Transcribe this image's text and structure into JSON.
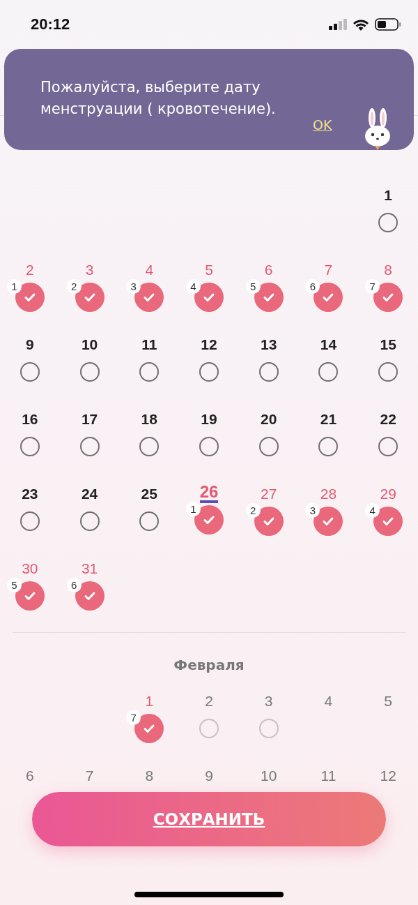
{
  "status_bar": {
    "time": "20:12"
  },
  "banner": {
    "message": "Пожалуйста, выберите дату менструации ( кровотечение).",
    "ok_link": "OK"
  },
  "months": [
    {
      "weeks": [
        [
          {
            "kind": "blank"
          },
          {
            "kind": "blank"
          },
          {
            "kind": "blank"
          },
          {
            "kind": "blank"
          },
          {
            "kind": "blank"
          },
          {
            "kind": "blank"
          },
          {
            "day": "1",
            "kind": "empty",
            "today": false
          }
        ],
        [
          {
            "day": "2",
            "kind": "checked",
            "order": "1",
            "today": false
          },
          {
            "day": "3",
            "kind": "checked",
            "order": "2",
            "today": false
          },
          {
            "day": "4",
            "kind": "checked",
            "order": "3",
            "today": false
          },
          {
            "day": "5",
            "kind": "checked",
            "order": "4",
            "today": false
          },
          {
            "day": "6",
            "kind": "checked",
            "order": "5",
            "today": false
          },
          {
            "day": "7",
            "kind": "checked",
            "order": "6",
            "today": false
          },
          {
            "day": "8",
            "kind": "checked",
            "order": "7",
            "today": false
          }
        ],
        [
          {
            "day": "9",
            "kind": "empty",
            "today": false
          },
          {
            "day": "10",
            "kind": "empty",
            "today": false
          },
          {
            "day": "11",
            "kind": "empty",
            "today": false
          },
          {
            "day": "12",
            "kind": "empty",
            "today": false
          },
          {
            "day": "13",
            "kind": "empty",
            "today": false
          },
          {
            "day": "14",
            "kind": "empty",
            "today": false
          },
          {
            "day": "15",
            "kind": "empty",
            "today": false
          }
        ],
        [
          {
            "day": "16",
            "kind": "empty",
            "today": false
          },
          {
            "day": "17",
            "kind": "empty",
            "today": false
          },
          {
            "day": "18",
            "kind": "empty",
            "today": false
          },
          {
            "day": "19",
            "kind": "empty",
            "today": false
          },
          {
            "day": "20",
            "kind": "empty",
            "today": false
          },
          {
            "day": "21",
            "kind": "empty",
            "today": false
          },
          {
            "day": "22",
            "kind": "empty",
            "today": false
          }
        ],
        [
          {
            "day": "23",
            "kind": "empty",
            "today": false
          },
          {
            "day": "24",
            "kind": "empty",
            "today": false
          },
          {
            "day": "25",
            "kind": "empty",
            "today": false
          },
          {
            "day": "26",
            "kind": "checked",
            "order": "1",
            "today": true
          },
          {
            "day": "27",
            "kind": "checked",
            "order": "2",
            "today": false
          },
          {
            "day": "28",
            "kind": "checked",
            "order": "3",
            "today": false
          },
          {
            "day": "29",
            "kind": "checked",
            "order": "4",
            "today": false
          }
        ],
        [
          {
            "day": "30",
            "kind": "checked",
            "order": "5",
            "today": false
          },
          {
            "day": "31",
            "kind": "checked",
            "order": "6",
            "today": false
          },
          {
            "kind": "blank"
          },
          {
            "kind": "blank"
          },
          {
            "kind": "blank"
          },
          {
            "kind": "blank"
          },
          {
            "kind": "blank"
          }
        ]
      ]
    },
    {
      "title": "Февраля",
      "weeks": [
        [
          {
            "kind": "blank"
          },
          {
            "kind": "blank"
          },
          {
            "day": "1",
            "kind": "checked",
            "order": "7",
            "today": false
          },
          {
            "day": "2",
            "kind": "future",
            "today": false
          },
          {
            "day": "3",
            "kind": "future",
            "today": false
          },
          {
            "day": "4",
            "kind": "plain",
            "today": false
          },
          {
            "day": "5",
            "kind": "plain",
            "today": false
          }
        ],
        [
          {
            "day": "6",
            "kind": "plain",
            "today": false
          },
          {
            "day": "7",
            "kind": "plain",
            "today": false
          },
          {
            "day": "8",
            "kind": "plain",
            "today": false
          },
          {
            "day": "9",
            "kind": "plain",
            "today": false
          },
          {
            "day": "10",
            "kind": "plain",
            "today": false
          },
          {
            "day": "11",
            "kind": "plain",
            "today": false
          },
          {
            "day": "12",
            "kind": "plain",
            "today": false
          }
        ]
      ]
    }
  ],
  "save_button": "СОХРАНИТЬ"
}
